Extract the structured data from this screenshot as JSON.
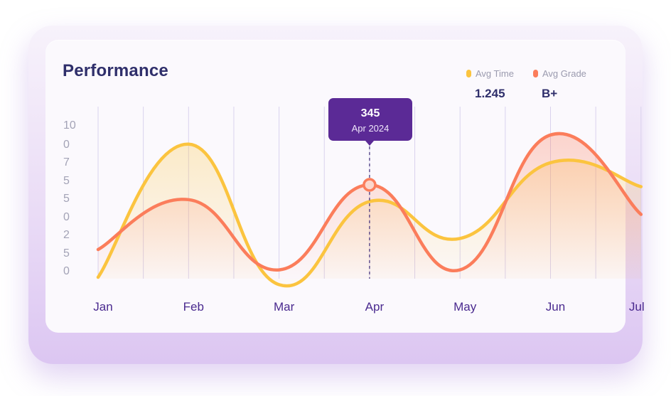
{
  "chart_data": {
    "type": "line",
    "title": "Performance",
    "categories": [
      "Jan",
      "Feb",
      "Mar",
      "Apr",
      "May",
      "Jun",
      "Jul"
    ],
    "y_tick_labels": [
      "10",
      "0",
      "7",
      "5",
      "5",
      "0",
      "2",
      "5",
      "0"
    ],
    "series": [
      {
        "name": "Avg Time",
        "color": "#fbc43f",
        "summary": "1.245",
        "values": [
          0,
          7.2,
          -0.4,
          4.1,
          2.1,
          6.2,
          4.9
        ]
      },
      {
        "name": "Avg Grade",
        "color": "#fb7d5b",
        "summary": "B+",
        "values": [
          1.5,
          4.2,
          0.4,
          5.0,
          0.4,
          7.7,
          3.4
        ]
      }
    ],
    "highlight": {
      "category": "Apr",
      "value": "345",
      "date": "Apr 2024"
    },
    "grid": "vertical",
    "legend": "top-right"
  }
}
